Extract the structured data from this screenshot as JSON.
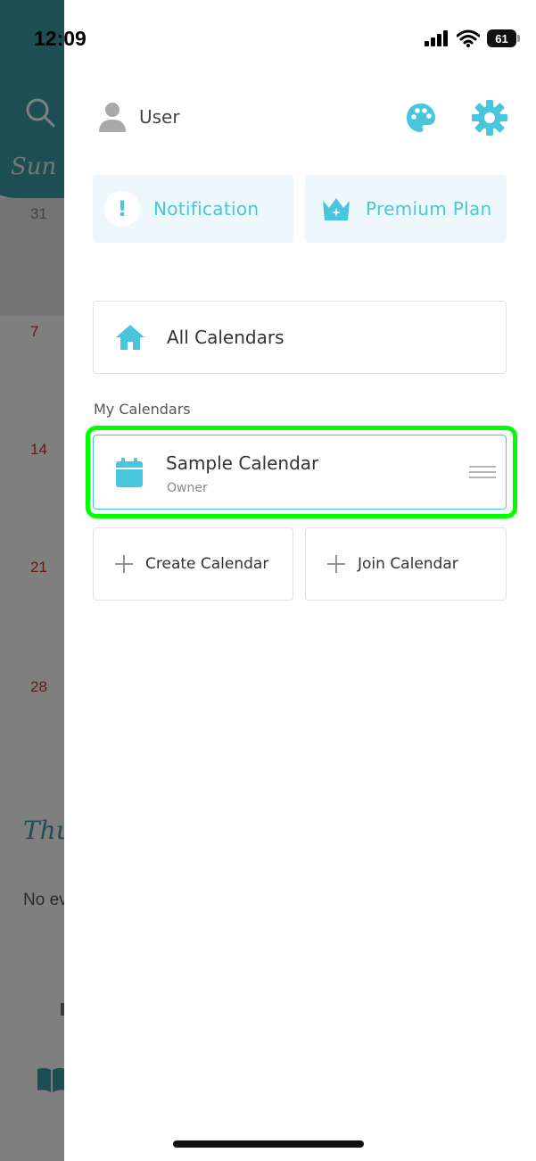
{
  "status_bar": {
    "time": "12:09",
    "battery": "61"
  },
  "background": {
    "weekday": "Sun",
    "days": [
      "31",
      "7",
      "14",
      "21",
      "28"
    ],
    "panel_title": "Thu",
    "panel_text": "No ev"
  },
  "drawer": {
    "user_name": "User",
    "notification_label": "Notification",
    "notification_icon": "!",
    "premium_label": "Premium Plan",
    "all_calendars_label": "All Calendars",
    "my_calendars_heading": "My Calendars",
    "calendars": [
      {
        "name": "Sample Calendar",
        "role": "Owner"
      }
    ],
    "create_calendar_label": "Create Calendar",
    "join_calendar_label": "Join Calendar"
  },
  "colors": {
    "accent": "#49c6dc",
    "card_bg": "#eef8fb",
    "header_teal": "#3a9ca6",
    "highlight": "#00ff00",
    "day_red": "#c0392b"
  },
  "icons": {
    "search": "search-icon",
    "avatar": "user-avatar-icon",
    "theme": "palette-icon",
    "settings": "gear-icon",
    "premium": "crown-icon",
    "home": "home-icon",
    "calendar": "calendar-icon",
    "drag": "drag-handle-icon",
    "add": "plus-icon",
    "guide": "book-icon"
  }
}
